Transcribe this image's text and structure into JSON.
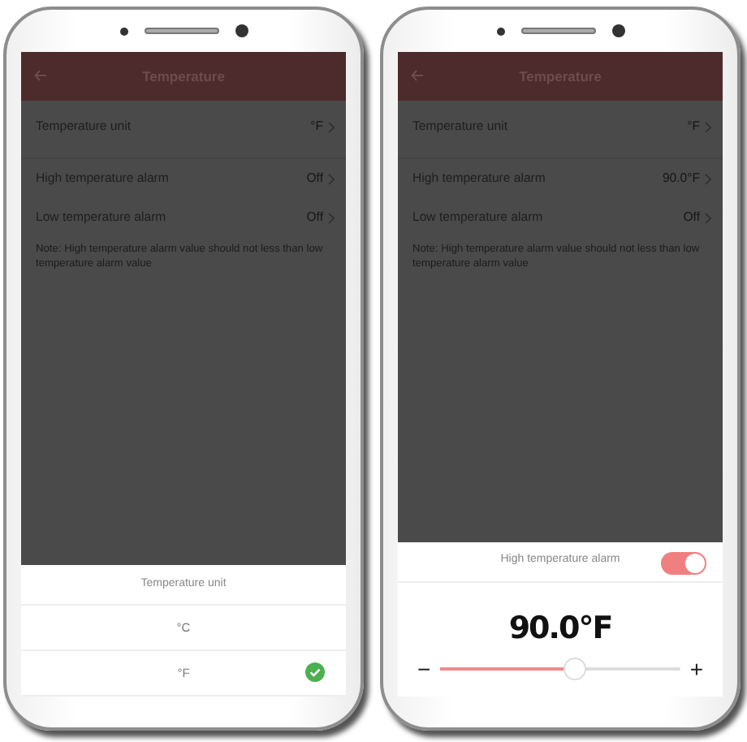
{
  "phones": [
    {
      "header": {
        "title": "Temperature"
      },
      "settings": [
        {
          "label": "Temperature unit",
          "value": "°F"
        },
        {
          "label": "High temperature alarm",
          "value": "Off"
        },
        {
          "label": "Low temperature alarm",
          "value": "Off"
        }
      ],
      "note": "Note: High temperature alarm value should not less than low temperature alarm value",
      "sheet": {
        "kind": "unit_picker",
        "title": "Temperature unit",
        "options": [
          {
            "label": "°C",
            "selected": false
          },
          {
            "label": "°F",
            "selected": true
          }
        ]
      }
    },
    {
      "header": {
        "title": "Temperature"
      },
      "settings": [
        {
          "label": "Temperature unit",
          "value": "°F"
        },
        {
          "label": "High temperature alarm",
          "value": "90.0°F"
        },
        {
          "label": "Low temperature alarm",
          "value": "Off"
        }
      ],
      "note": "Note: High temperature alarm value should not less than low temperature alarm value",
      "sheet": {
        "kind": "alarm_editor",
        "title": "High temperature alarm",
        "on": true,
        "value": "90.0°F",
        "minus": "−",
        "plus": "+",
        "level": 0.56
      }
    }
  ]
}
